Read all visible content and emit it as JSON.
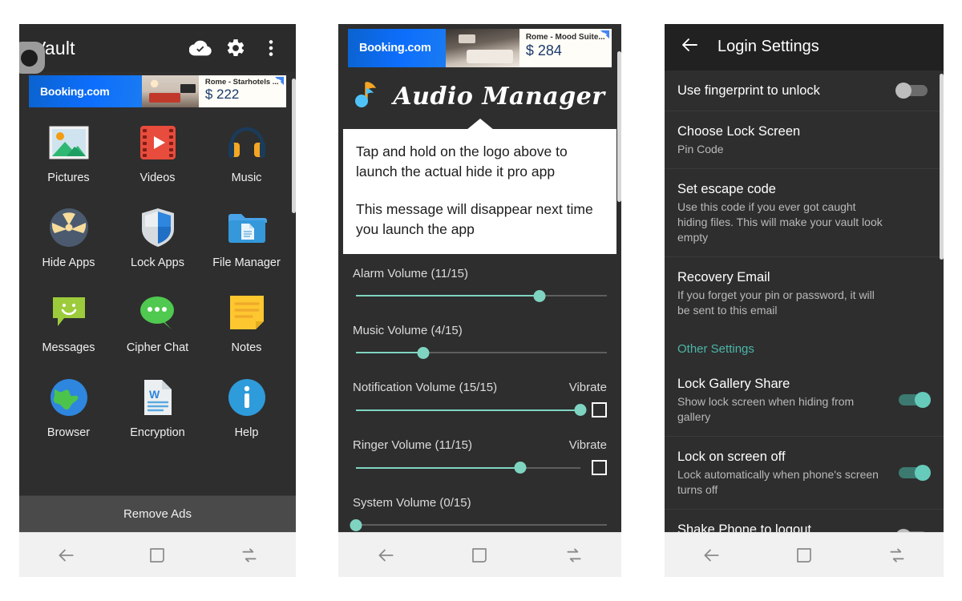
{
  "panels": {
    "vault": {
      "appbar": {
        "title": "Vault",
        "icons": [
          "cloud-check-icon",
          "gear-icon",
          "overflow-menu-icon"
        ]
      },
      "ad": {
        "brand": "Booking.com",
        "headline": "Rome - Starhotels ...",
        "price": "$ 222",
        "adchoices": "adchoices-icon"
      },
      "apps": [
        {
          "label": "Pictures",
          "icon": "pictures-icon"
        },
        {
          "label": "Videos",
          "icon": "videos-icon"
        },
        {
          "label": "Music",
          "icon": "music-icon"
        },
        {
          "label": "Hide Apps",
          "icon": "hide-apps-icon"
        },
        {
          "label": "Lock Apps",
          "icon": "lock-apps-icon"
        },
        {
          "label": "File Manager",
          "icon": "file-manager-icon"
        },
        {
          "label": "Messages",
          "icon": "messages-icon"
        },
        {
          "label": "Cipher Chat",
          "icon": "cipher-chat-icon"
        },
        {
          "label": "Notes",
          "icon": "notes-icon"
        },
        {
          "label": "Browser",
          "icon": "browser-icon"
        },
        {
          "label": "Encryption",
          "icon": "encryption-icon"
        },
        {
          "label": "Help",
          "icon": "help-icon"
        }
      ],
      "remove_ads_label": "Remove Ads"
    },
    "audio": {
      "ad": {
        "brand": "Booking.com",
        "headline": "Rome - Mood Suite...",
        "price": "$ 284",
        "adchoices": "adchoices-icon"
      },
      "logo_text": "Audio Manager",
      "logo_icon": "music-note-icon",
      "tip": {
        "line1": "Tap and hold on the logo above to launch the actual hide it pro app",
        "line2": "This message will disappear next time you launch the app"
      },
      "sliders": [
        {
          "label": "Alarm Volume (11/15)",
          "value": 11,
          "max": 15,
          "vibrate": null,
          "vibrate_checked": false
        },
        {
          "label": "Music Volume (4/15)",
          "value": 4,
          "max": 15,
          "vibrate": null,
          "vibrate_checked": false
        },
        {
          "label": "Notification Volume (15/15)",
          "value": 15,
          "max": 15,
          "vibrate": "Vibrate",
          "vibrate_checked": false
        },
        {
          "label": "Ringer Volume (11/15)",
          "value": 11,
          "max": 15,
          "vibrate": "Vibrate",
          "vibrate_checked": false
        },
        {
          "label": "System Volume (0/15)",
          "value": 0,
          "max": 15,
          "vibrate": null,
          "vibrate_checked": false
        }
      ]
    },
    "login": {
      "appbar": {
        "back_icon": "back-arrow-icon",
        "title": "Login Settings"
      },
      "rows": [
        {
          "title": "Use fingerprint to unlock",
          "sub": "",
          "toggle": "off"
        },
        {
          "title": "Choose Lock Screen",
          "sub": "Pin Code",
          "toggle": null
        },
        {
          "title": "Set escape code",
          "sub": "Use this code if you ever got caught hiding files. This will make your vault look empty",
          "toggle": null
        },
        {
          "title": "Recovery Email",
          "sub": "If you forget your pin or password, it will be sent to this email",
          "toggle": null
        }
      ],
      "section_label": "Other Settings",
      "rows2": [
        {
          "title": "Lock Gallery Share",
          "sub": "Show lock screen when hiding from gallery",
          "toggle": "on"
        },
        {
          "title": "Lock on screen off",
          "sub": "Lock automatically when phone's screen turns off",
          "toggle": "on"
        },
        {
          "title": "Shake Phone to logout",
          "sub": "",
          "toggle": "off"
        }
      ]
    }
  },
  "navbar": {
    "back": "back-nav-icon",
    "home": "home-nav-icon",
    "recents": "recents-nav-icon"
  },
  "colors": {
    "panel_bg": "#2e2e2e",
    "appbar_bg": "#2b2b2b",
    "accent_teal": "#7fd4c1",
    "section_teal": "#4cb6a8",
    "navbar_bg": "#f1f1f1",
    "booking_blue": "#0d6efd"
  }
}
